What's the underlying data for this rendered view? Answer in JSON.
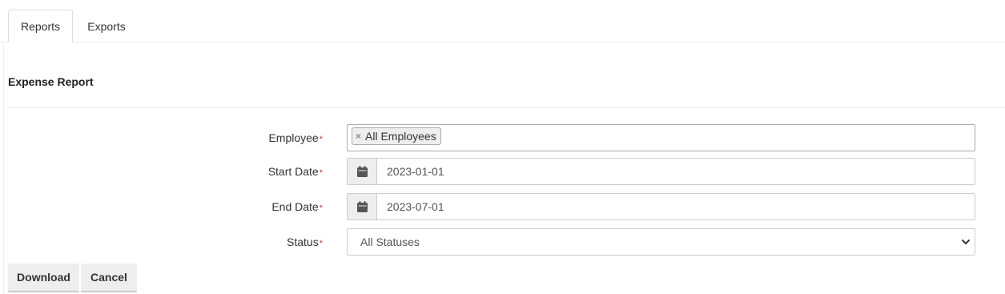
{
  "tabs": [
    {
      "label": "Reports",
      "active": true
    },
    {
      "label": "Exports",
      "active": false
    }
  ],
  "section_title": "Expense Report",
  "form": {
    "employee": {
      "label": "Employee",
      "required_mark": "*",
      "selected_tag": "All Employees",
      "remove_glyph": "×"
    },
    "start_date": {
      "label": "Start Date",
      "required_mark": "*",
      "value": "2023-01-01",
      "icon": "calendar-icon"
    },
    "end_date": {
      "label": "End Date",
      "required_mark": "*",
      "value": "2023-07-01",
      "icon": "calendar-icon"
    },
    "status": {
      "label": "Status",
      "required_mark": "*",
      "selected": "All Statuses",
      "icon": "chevron-down-icon"
    }
  },
  "buttons": {
    "download": "Download",
    "cancel": "Cancel"
  },
  "colors": {
    "required": "#c0392b",
    "button_bg": "#eeeeee"
  }
}
